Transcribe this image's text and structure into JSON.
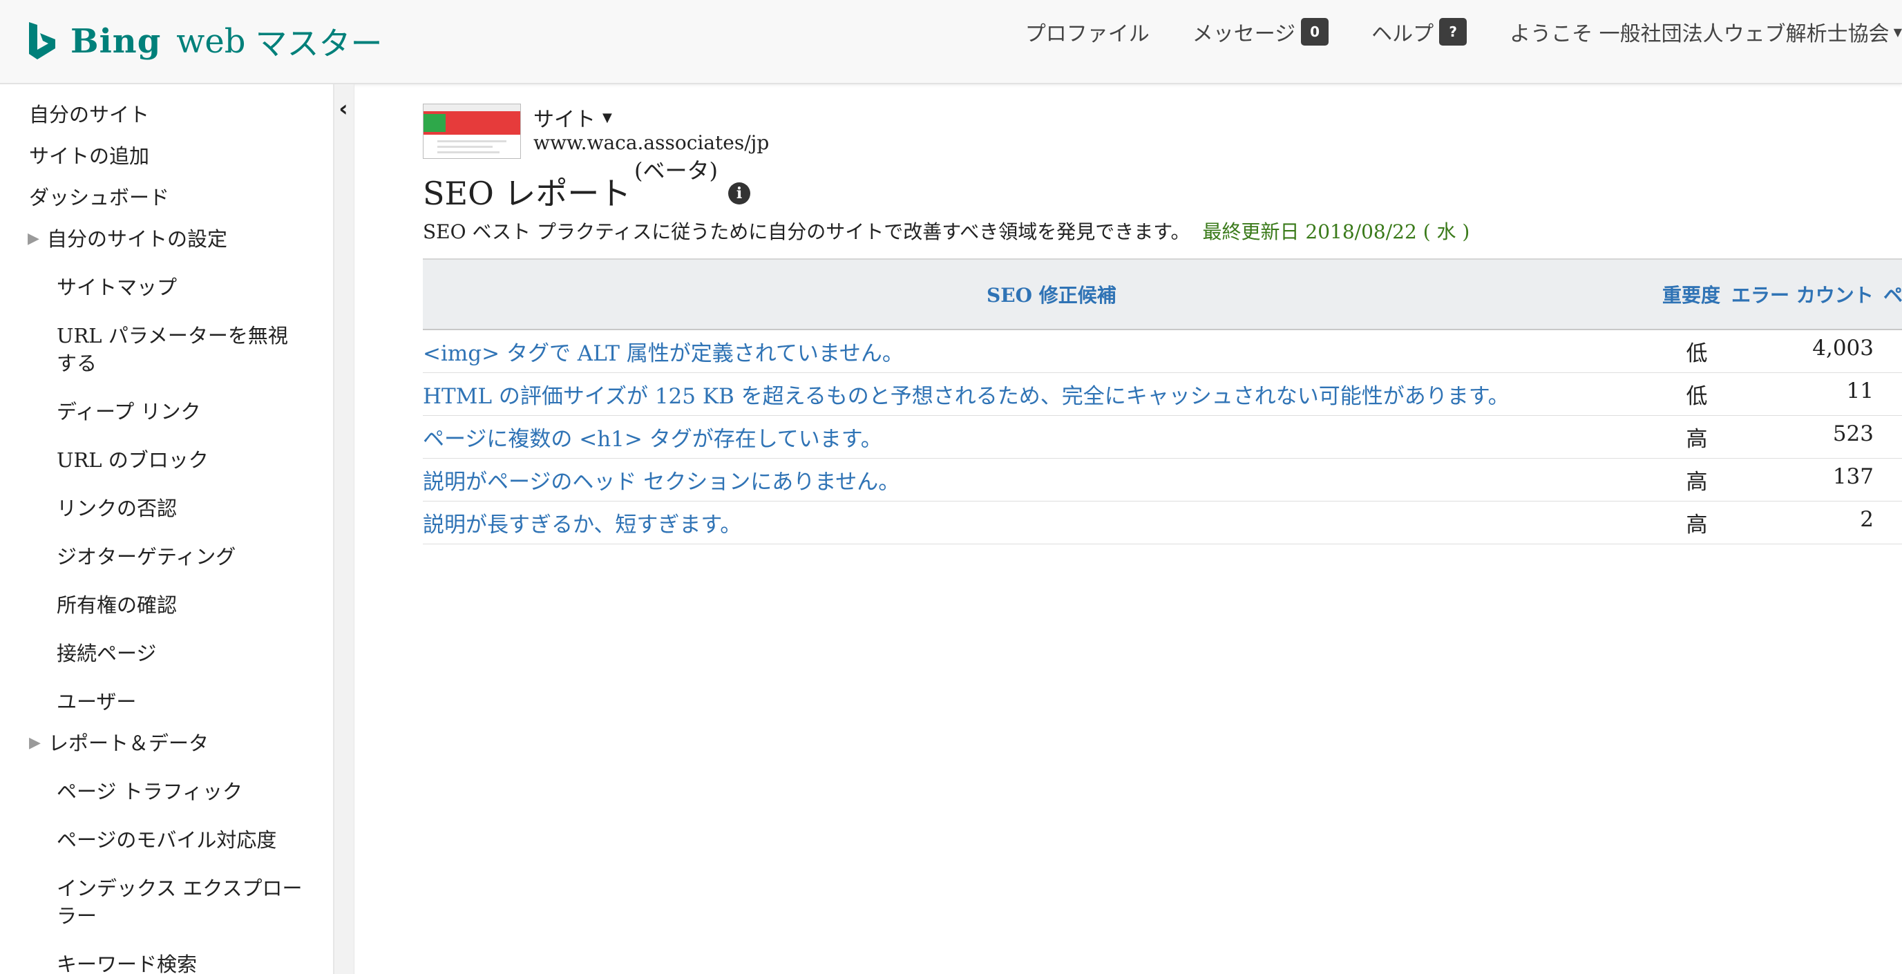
{
  "header": {
    "logo_bing": "Bing",
    "logo_web": "web",
    "logo_master": "マスター",
    "nav": {
      "profile": "プロファイル",
      "messages": "メッセージ",
      "messages_count": "0",
      "help": "ヘルプ",
      "help_badge": "?",
      "welcome": "ようこそ 一般社団法人ウェブ解析士協会"
    }
  },
  "sidebar": {
    "items": [
      {
        "label": "自分のサイト"
      },
      {
        "label": "サイトの追加"
      },
      {
        "label": "ダッシュボード"
      },
      {
        "label": "自分のサイトの設定"
      },
      {
        "label": "サイトマップ"
      },
      {
        "label": "URL パラメーターを無視する"
      },
      {
        "label": "ディープ リンク"
      },
      {
        "label": "URL のブロック"
      },
      {
        "label": "リンクの否認"
      },
      {
        "label": "ジオターゲティング"
      },
      {
        "label": "所有権の確認"
      },
      {
        "label": "接続ページ"
      },
      {
        "label": "ユーザー"
      },
      {
        "label": "レポート＆データ"
      },
      {
        "label": "ページ トラフィック"
      },
      {
        "label": "ページのモバイル対応度"
      },
      {
        "label": "インデックス エクスプローラー"
      },
      {
        "label": "キーワード検索"
      }
    ]
  },
  "site": {
    "label": "サイト",
    "url": "www.waca.associates/jp"
  },
  "page": {
    "title": "SEO レポート",
    "beta": "(ベータ)",
    "info": "i",
    "description": "SEO ベスト プラクティスに従うために自分のサイトで改善すべき領域を発見できます。",
    "updated": "最終更新日 2018/08/22 ( 水 )"
  },
  "table": {
    "headers": {
      "suggestion": "SEO 修正候補",
      "severity": "重要度",
      "error_count": "エラー カウント",
      "extra": "ペ"
    },
    "rows": [
      {
        "suggestion": "<img> タグで ALT 属性が定義されていません。",
        "severity": "低",
        "count": "4,003"
      },
      {
        "suggestion": "HTML の評価サイズが 125 KB を超えるものと予想されるため、完全にキャッシュされない可能性があります。",
        "severity": "低",
        "count": "11"
      },
      {
        "suggestion": "ページに複数の <h1> タグが存在しています。",
        "severity": "高",
        "count": "523"
      },
      {
        "suggestion": "説明がページのヘッド セクションにありません。",
        "severity": "高",
        "count": "137"
      },
      {
        "suggestion": "説明が長すぎるか、短すぎます。",
        "severity": "高",
        "count": "2"
      }
    ]
  },
  "colors": {
    "brand": "#00807a",
    "link": "#2f73b5",
    "updated": "#3a7a1a",
    "badge": "#3d3d3d"
  }
}
